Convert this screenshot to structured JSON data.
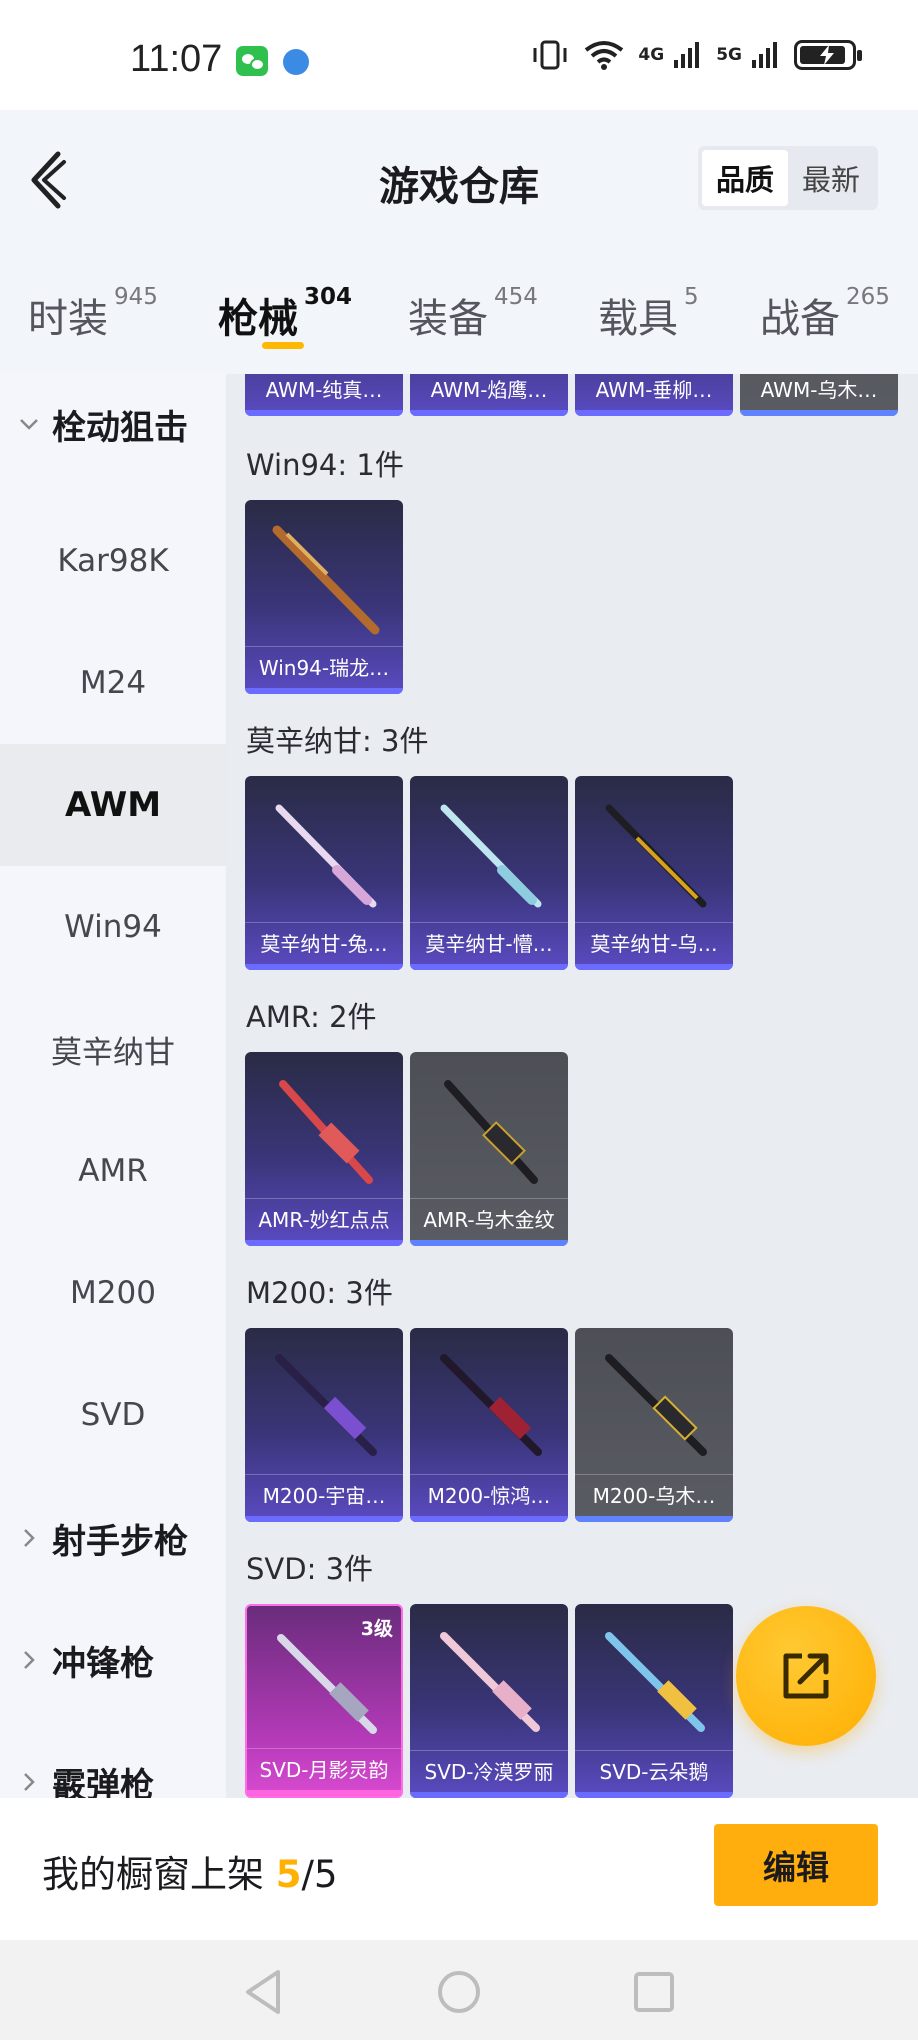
{
  "status_bar": {
    "time": "11:07",
    "net1": "4G",
    "net2": "5G",
    "battery_level": 0.9
  },
  "header": {
    "title": "游戏仓库",
    "sort_options": [
      "品质",
      "最新"
    ],
    "sort_active": "品质"
  },
  "tabs": [
    {
      "label": "时装",
      "count": "945"
    },
    {
      "label": "枪械",
      "count": "304",
      "active": true
    },
    {
      "label": "装备",
      "count": "454"
    },
    {
      "label": "载具",
      "count": "5"
    },
    {
      "label": "战备",
      "count": "265"
    }
  ],
  "sidebar": {
    "group_sniper": "栓动狙击",
    "items": [
      "Kar98K",
      "M24",
      "AWM",
      "Win94",
      "莫辛纳甘",
      "AMR",
      "M200",
      "SVD"
    ],
    "active_item": "AWM",
    "group_dmr": "射手步枪",
    "group_smg": "冲锋枪",
    "group_shotgun": "霰弹枪"
  },
  "content": {
    "awm_cards": [
      "AWM-纯真…",
      "AWM-焰鹰…",
      "AWM-垂柳…",
      "AWM-乌木…"
    ],
    "sections": [
      {
        "label": "Win94: 1件",
        "cards": [
          "Win94-瑞龙…"
        ]
      },
      {
        "label": "莫辛纳甘: 3件",
        "cards": [
          "莫辛纳甘-兔…",
          "莫辛纳甘-懵…",
          "莫辛纳甘-乌…"
        ]
      },
      {
        "label": "AMR: 2件",
        "cards": [
          "AMR-妙红点点",
          "AMR-乌木金纹"
        ]
      },
      {
        "label": "M200: 3件",
        "cards": [
          "M200-宇宙…",
          "M200-惊鸿…",
          "M200-乌木…"
        ]
      },
      {
        "label": "SVD: 3件",
        "cards": [
          "SVD-月影灵韵",
          "SVD-冷漠罗丽",
          "SVD-云朵鹅"
        ],
        "level_badge": "3级"
      }
    ]
  },
  "bottom": {
    "shelf_label": "我的橱窗上架 ",
    "shelf_current": "5",
    "shelf_total": "/5",
    "edit_label": "编辑"
  },
  "colors": {
    "accent": "#ffae0d",
    "card_purple": "#3a3579",
    "card_grey": "#5a5c63",
    "card_pink": "#b43ab8"
  }
}
